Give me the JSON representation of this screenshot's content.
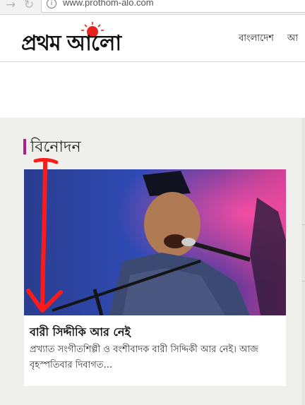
{
  "browser": {
    "url": "www.prothom-alo.com",
    "back_icon": "arrow-left-icon",
    "reload_icon": "reload-icon"
  },
  "header": {
    "logo_text": "প্রথম আলো",
    "nav_items": [
      "বাংলাদেশ",
      "আ"
    ]
  },
  "section": {
    "title": "বিনোদন",
    "accent_color": "#b01d8f"
  },
  "article": {
    "headline": "বারী সিদ্দীকি আর নেই",
    "summary": "প্রখ্যাত সংগীতশিল্পী ও বংশীবাদক বারী সিদ্দিকী আর নেই। আজ বৃহস্পতিবার দিবাগত..."
  },
  "annotation": {
    "color": "#ff1a1a",
    "shape": "red-arrow-down"
  }
}
